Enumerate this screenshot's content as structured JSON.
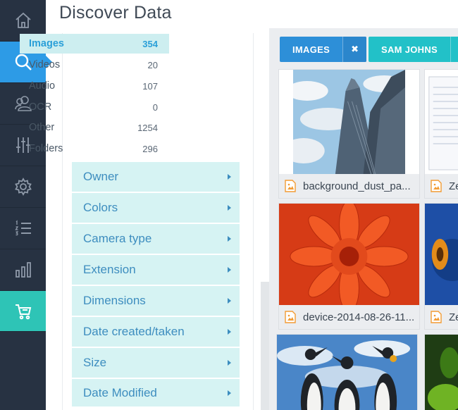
{
  "header": {
    "title": "Discover Data"
  },
  "rail": {
    "items": [
      {
        "icon": "home-icon",
        "active": ""
      },
      {
        "icon": "search-icon",
        "active": "blue"
      },
      {
        "icon": "users-icon",
        "active": ""
      },
      {
        "icon": "sliders-icon",
        "active": ""
      },
      {
        "icon": "gear-icon",
        "active": ""
      },
      {
        "icon": "numbered-list-icon",
        "active": ""
      },
      {
        "icon": "bar-chart-icon",
        "active": ""
      },
      {
        "icon": "cart-icon",
        "active": "teal"
      }
    ]
  },
  "filters": {
    "types": [
      {
        "label": "Images",
        "count": "354",
        "selected": true
      },
      {
        "label": "Videos",
        "count": "20",
        "selected": false
      },
      {
        "label": "Audio",
        "count": "107",
        "selected": false
      },
      {
        "label": "OCR",
        "count": "0",
        "selected": false
      },
      {
        "label": "Other",
        "count": "1254",
        "selected": false
      },
      {
        "label": "Folders",
        "count": "296",
        "selected": false
      }
    ],
    "facets": [
      "Owner",
      "Colors",
      "Camera type",
      "Extension",
      "Dimensions",
      "Date created/taken",
      "Size",
      "Date Modified"
    ]
  },
  "active_tags": [
    {
      "label": "IMAGES",
      "close": "✖",
      "color": "#2d8fd8"
    },
    {
      "label": "SAM JOHNS",
      "close": "✖",
      "color": "#22c1c8"
    }
  ],
  "results": [
    {
      "name": "background_dust_pa...",
      "icon": "image-file-icon"
    },
    {
      "name": "Ze",
      "icon": "image-file-icon"
    },
    {
      "name": "device-2014-08-26-11...",
      "icon": "image-file-icon"
    },
    {
      "name": "Ze",
      "icon": "image-file-icon"
    }
  ],
  "colors": {
    "rail_bg": "#273242",
    "accent_blue": "#2d9be6",
    "accent_teal": "#2ec4b6",
    "facet_bg": "#d6f3f3"
  }
}
